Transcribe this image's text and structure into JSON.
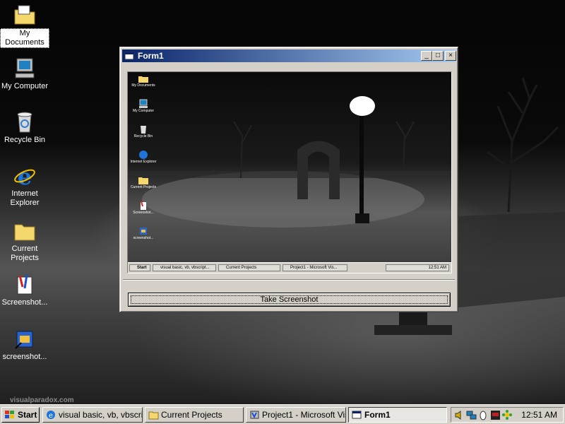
{
  "desktop": {
    "icons": [
      {
        "label": "My Documents",
        "icon": "folder-documents-icon"
      },
      {
        "label": "My Computer",
        "icon": "computer-icon"
      },
      {
        "label": "Recycle Bin",
        "icon": "recycle-bin-icon"
      },
      {
        "label": "Internet Explorer",
        "icon": "internet-explorer-icon"
      },
      {
        "label": "Current Projects",
        "icon": "folder-icon"
      },
      {
        "label": "Screenshot...",
        "icon": "paint-shortcut-icon"
      },
      {
        "label": "screenshot...",
        "icon": "vb-project-icon"
      }
    ],
    "watermark": "visualparadox.com"
  },
  "window": {
    "title": "Form1",
    "minimize": "_",
    "maximize": "□",
    "close": "×",
    "button_label": "Take Screenshot"
  },
  "captured": {
    "icons": [
      "My Documents",
      "My Computer",
      "Recycle Bin",
      "Internet Explorer",
      "Current Projects",
      "Screenshot...",
      "screenshot..."
    ],
    "taskbar": {
      "start": "Start",
      "items": [
        "visual basic, vb, vbscript...",
        "Current Projects",
        "Project1 - Microsoft Vis..."
      ],
      "clock": "12:51 AM"
    }
  },
  "taskbar": {
    "start_label": "Start",
    "items": [
      {
        "label": "visual basic, vb, vbscri...",
        "icon": "internet-explorer-icon",
        "active": false
      },
      {
        "label": "Current Projects",
        "icon": "folder-icon",
        "active": false
      },
      {
        "label": "Project1 - Microsoft Vis...",
        "icon": "vb-icon",
        "active": false
      },
      {
        "label": "Form1",
        "icon": "form-icon",
        "active": true
      }
    ],
    "tray_icons": [
      "speaker-icon",
      "network-icon",
      "mouse-icon",
      "pdf-icon",
      "flower-icon"
    ],
    "clock": "12:51 AM"
  },
  "colors": {
    "titlebar_start": "#0a246a",
    "titlebar_end": "#a6caf0",
    "face": "#d4d0c8"
  }
}
